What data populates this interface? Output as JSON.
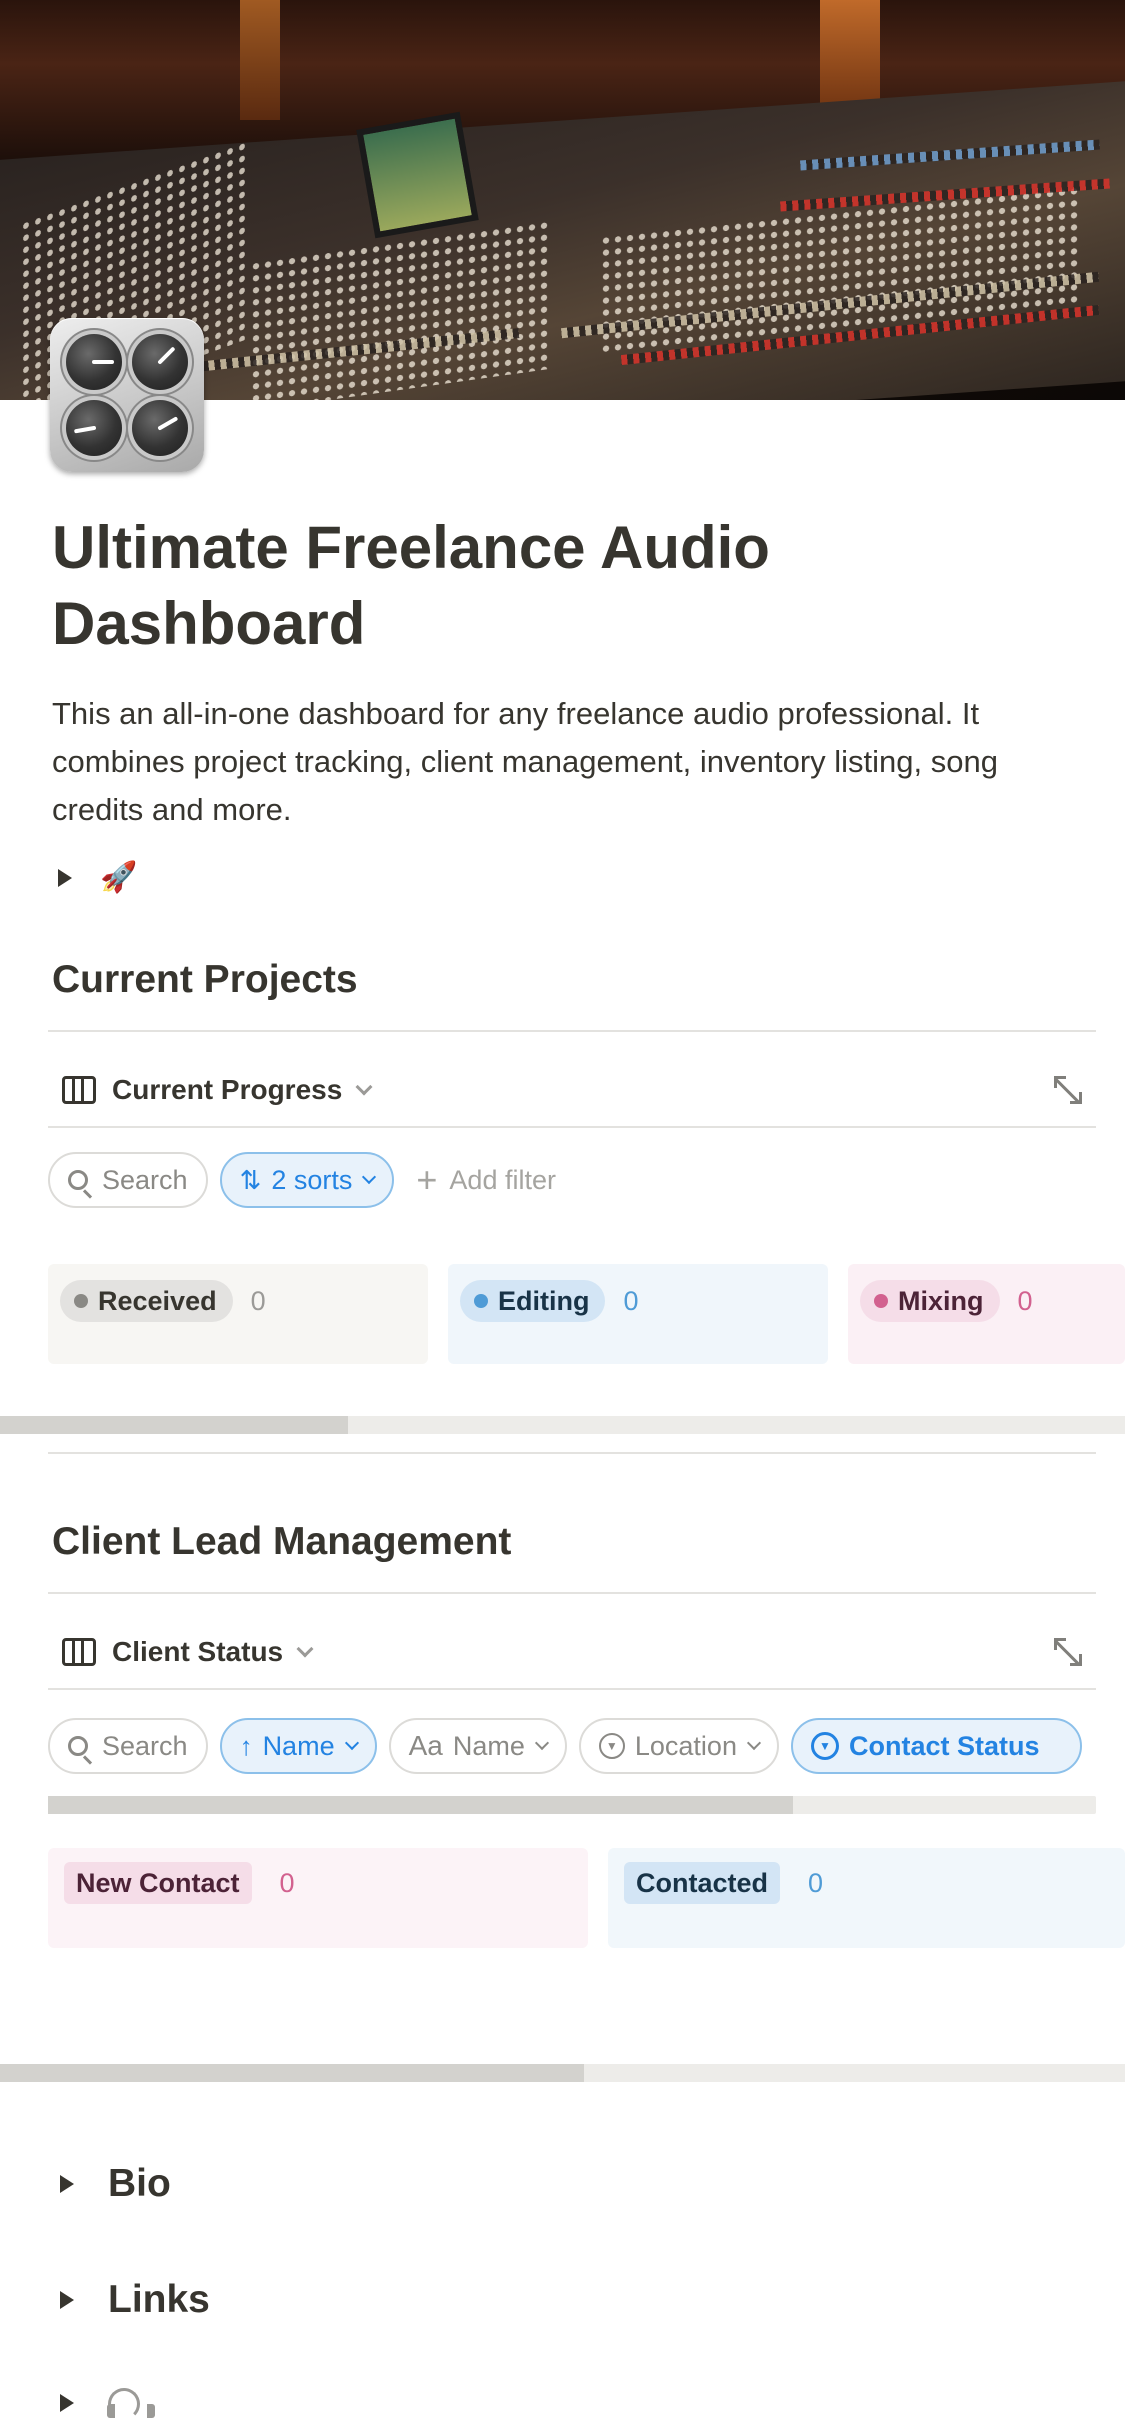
{
  "page": {
    "title": "Ultimate Freelance Audio Dashboard",
    "description": "This an all-in-one dashboard for any freelance audio professional. It combines project tracking, client management, inventory listing, song credits and more.",
    "toggle_emoji": "🚀",
    "icon": "mixer-knobs-icon"
  },
  "current_projects": {
    "heading": "Current Projects",
    "view_name": "Current Progress",
    "search_label": "Search",
    "sorts_label": "2 sorts",
    "add_filter_label": "Add filter",
    "columns": [
      {
        "label": "Received",
        "count": "0",
        "color": "#8a8985"
      },
      {
        "label": "Editing",
        "count": "0",
        "color": "#4f9bd6"
      },
      {
        "label": "Mixing",
        "count": "0",
        "color": "#d2618f"
      }
    ]
  },
  "client_leads": {
    "heading": "Client Lead Management",
    "view_name": "Client Status",
    "search_label": "Search",
    "filters": [
      {
        "label": "Name",
        "icon": "arrow-up-icon",
        "active": true
      },
      {
        "label": "Name",
        "icon": "text-aa-icon",
        "active": false
      },
      {
        "label": "Location",
        "icon": "select-icon",
        "active": false
      },
      {
        "label": "Contact Status",
        "icon": "select-icon",
        "active": true
      }
    ],
    "columns": [
      {
        "label": "New Contact",
        "count": "0",
        "color": "#d2618f"
      },
      {
        "label": "Contacted",
        "count": "0",
        "color": "#4f9bd6"
      }
    ]
  },
  "toggles": [
    {
      "label": "Bio"
    },
    {
      "label": "Links"
    },
    {
      "label": ""
    }
  ]
}
